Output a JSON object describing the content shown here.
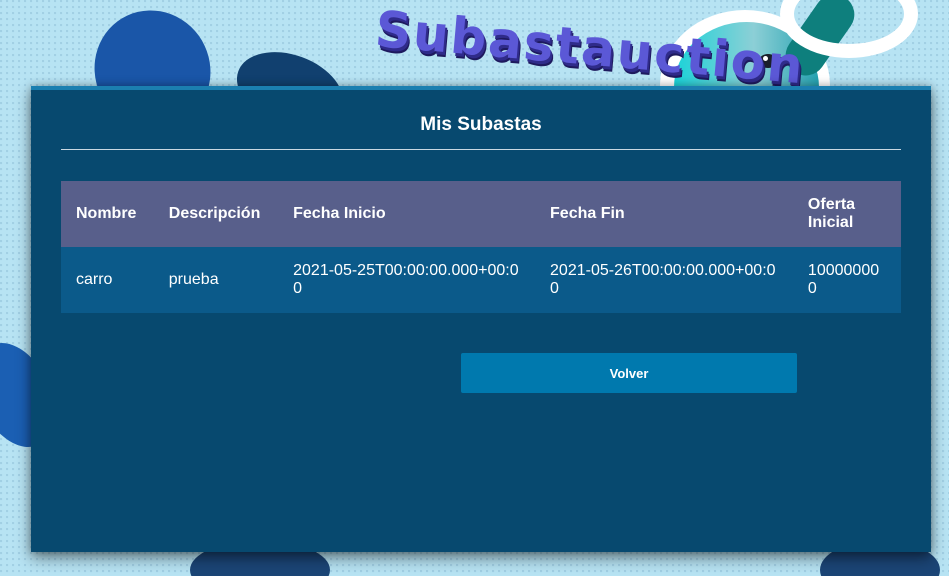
{
  "brand": {
    "logo_text": "Subastauction"
  },
  "page": {
    "title": "Mis Subastas"
  },
  "table": {
    "headers": {
      "nombre": "Nombre",
      "descripcion": "Descripción",
      "fecha_inicio": "Fecha Inicio",
      "fecha_fin": "Fecha Fin",
      "oferta_inicial": "Oferta Inicial"
    },
    "rows": [
      {
        "nombre": "carro",
        "descripcion": "prueba",
        "fecha_inicio": "2021-05-25T00:00:00.000+00:00",
        "fecha_fin": "2021-05-26T00:00:00.000+00:00",
        "oferta_inicial": "100000000"
      }
    ]
  },
  "actions": {
    "back_label": "Volver"
  },
  "colors": {
    "panel_bg": "#07496f",
    "header_row_bg": "#585f8b",
    "body_row_bg": "#0b5a8a",
    "button_bg": "#0079ae",
    "page_bg": "#b7e3f3"
  }
}
